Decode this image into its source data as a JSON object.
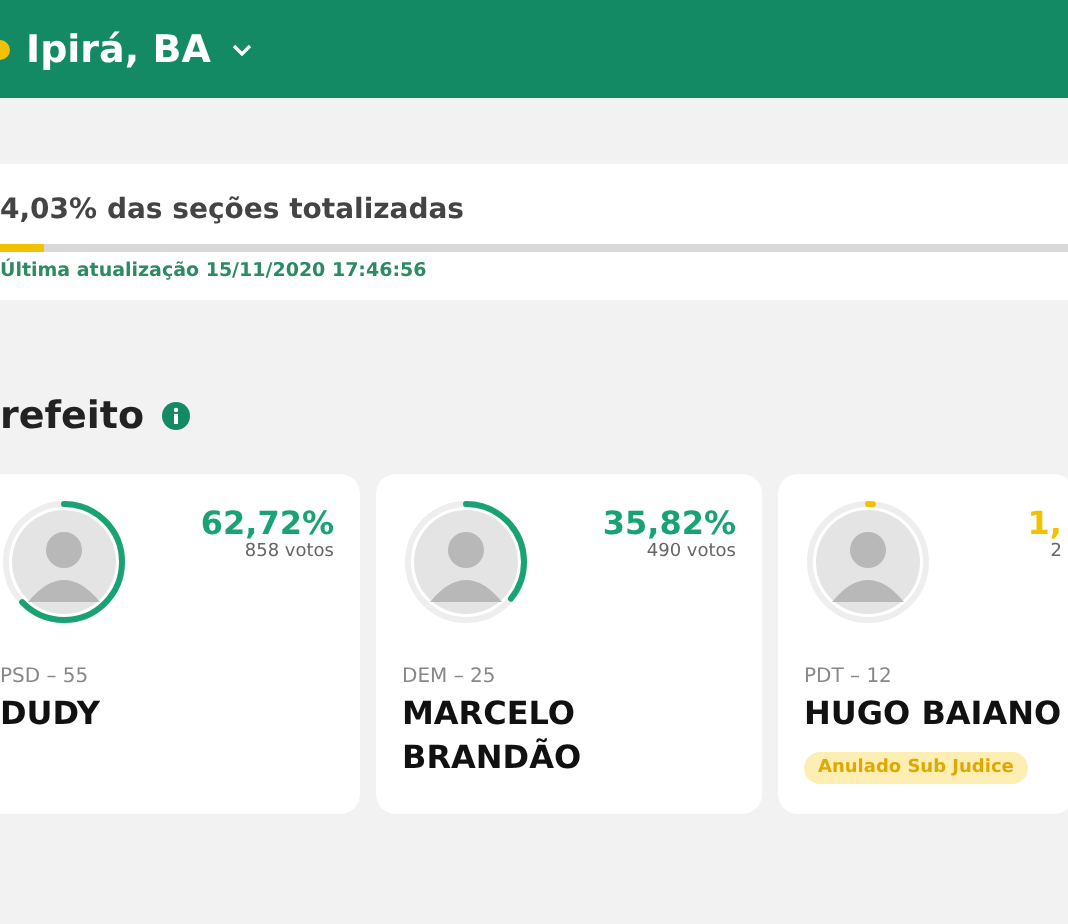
{
  "header": {
    "title": "Ipirá, BA"
  },
  "progress": {
    "text": "4,03% das seções totalizadas",
    "level": 0.0403,
    "updated": "Última atualização 15/11/2020 17:46:56"
  },
  "section": {
    "title": "refeito"
  },
  "candidates": [
    {
      "percent": "62,72%",
      "votes": "858 votos",
      "party": "PSD – 55",
      "name": "DUDY",
      "level": 0.6272,
      "color": "#1aa372"
    },
    {
      "percent": "35,82%",
      "votes": "490 votos",
      "party": "DEM – 25",
      "name": "MARCELO BRANDÃO",
      "level": 0.3582,
      "color": "#1aa372"
    },
    {
      "percent": "1,",
      "votes": "2",
      "party": "PDT – 12",
      "name": "HUGO BAIANO",
      "level": 0.014,
      "color": "#f2c200",
      "badge": "Anulado Sub Judice"
    }
  ]
}
